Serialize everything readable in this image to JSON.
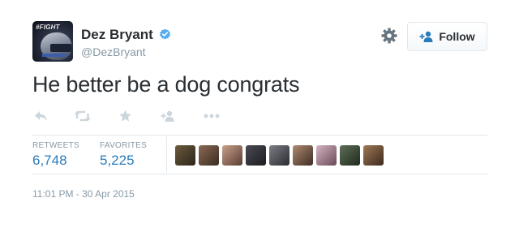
{
  "user": {
    "name": "Dez Bryant",
    "handle": "@DezBryant",
    "avatar_text": "#FIGHT",
    "verified": true
  },
  "follow_button": {
    "label": "Follow"
  },
  "tweet": {
    "text": "He better be a dog congrats"
  },
  "actions": [
    "reply-icon",
    "retweet-icon",
    "favorite-icon",
    "add-user-icon",
    "more-icon"
  ],
  "stats": {
    "retweets": {
      "label": "RETWEETS",
      "value": "6,748"
    },
    "favorites": {
      "label": "FAVORITES",
      "value": "5,225"
    }
  },
  "favoriters_count_shown": 9,
  "timestamp": "11:01 PM - 30 Apr 2015",
  "colors": {
    "text": "#292f33",
    "muted": "#8899a6",
    "link": "#2b7bb9",
    "verified": "#55acee",
    "icon": "#ccd6dd",
    "border": "#e1e8ed"
  }
}
